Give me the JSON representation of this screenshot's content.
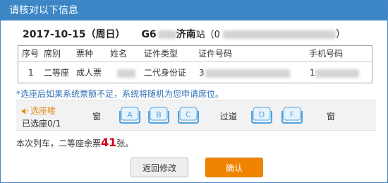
{
  "dialog": {
    "title": "请核对以下信息"
  },
  "train": {
    "date": "2017-10-15（周日）",
    "train_no_prefix": "G6",
    "station": "济南",
    "station_suffix": "站（0",
    "tail": "）"
  },
  "table": {
    "headers": [
      "序号",
      "席别",
      "票种",
      "姓名",
      "证件类型",
      "证件号码",
      "手机号码"
    ],
    "row": {
      "index": "1",
      "seat_class": "二等座",
      "ticket_type": "成人票",
      "id_type": "二代身份证",
      "id_prefix": "3",
      "phone_prefix": "1"
    }
  },
  "notice": "*选座后如果系统票额不足，系统将随机为您申请席位。",
  "seat_selector": {
    "title": "选座喽",
    "count": "已选座0/1",
    "window_left": "窗",
    "aisle": "过道",
    "window_right": "窗",
    "seats": [
      "A",
      "B",
      "C",
      "D",
      "F"
    ]
  },
  "remaining": {
    "prefix": "本次列车，二等座余票",
    "count": "41",
    "suffix": "张。"
  },
  "buttons": {
    "back": "返回修改",
    "confirm": "确认"
  },
  "colors": {
    "title_bar": "#3d86c6",
    "accent": "#f08400",
    "seat_icon": "#4fa3e0",
    "remaining_count": "#d0021b"
  }
}
